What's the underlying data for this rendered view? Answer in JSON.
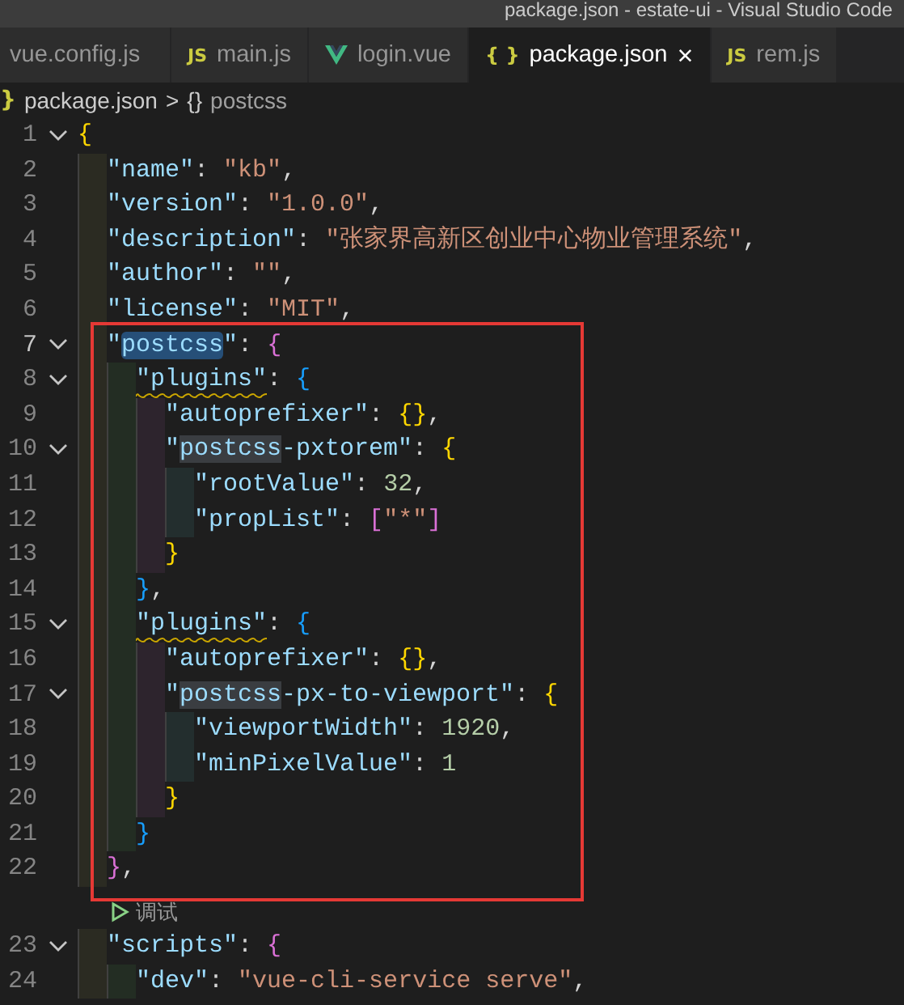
{
  "window": {
    "title": "package.json - estate-ui - Visual Studio Code"
  },
  "tabs": [
    {
      "label": "vue.config.js",
      "selected": false
    },
    {
      "label": "main.js",
      "kind": "js",
      "icon_text": "JS",
      "selected": false
    },
    {
      "label": "login.vue",
      "kind": "vue",
      "selected": false
    },
    {
      "label": "package.json",
      "kind": "json",
      "icon_text": "{ }",
      "selected": true,
      "close_glyph": "×"
    },
    {
      "label": "rem.js",
      "kind": "js",
      "icon_text": "JS",
      "selected": false
    }
  ],
  "breadcrumb": {
    "separator": ">",
    "items": [
      {
        "icon_text": "}",
        "label": "package.json"
      },
      {
        "icon_text": "{}",
        "label": "postcss"
      }
    ]
  },
  "editor": {
    "lines": [
      {
        "kind": "code",
        "n": "1",
        "fold": true,
        "seg": [
          {
            "kind": "b1",
            "t": "{"
          }
        ],
        "children": [
          {
            "kind": "code",
            "n": "2",
            "seg": [
              {
                "kind": "key",
                "t": "\"name\""
              },
              {
                "kind": "p",
                "t": ":"
              },
              {
                "kind": "str",
                "t": "\"kb\""
              },
              {
                "kind": "p",
                "t": ","
              }
            ]
          },
          {
            "kind": "code",
            "n": "3",
            "seg": [
              {
                "kind": "key",
                "t": "\"version\""
              },
              {
                "kind": "p",
                "t": ":"
              },
              {
                "kind": "str",
                "t": "\"1.0.0\""
              },
              {
                "kind": "p",
                "t": ","
              }
            ]
          },
          {
            "kind": "code",
            "n": "4",
            "seg": [
              {
                "kind": "key",
                "t": "\"description\""
              },
              {
                "kind": "p",
                "t": ":"
              },
              {
                "kind": "str",
                "t": "\"张家界高新区创业中心物业管理系统\""
              },
              {
                "kind": "p",
                "t": ","
              }
            ]
          },
          {
            "kind": "code",
            "n": "5",
            "seg": [
              {
                "kind": "key",
                "t": "\"author\""
              },
              {
                "kind": "p",
                "t": ":"
              },
              {
                "kind": "str",
                "t": "\"\""
              },
              {
                "kind": "p",
                "t": ","
              }
            ]
          },
          {
            "kind": "code",
            "n": "6",
            "seg": [
              {
                "kind": "key",
                "t": "\"license\""
              },
              {
                "kind": "p",
                "t": ":"
              },
              {
                "kind": "str",
                "t": "\"MIT\""
              },
              {
                "kind": "p",
                "t": ","
              }
            ]
          },
          {
            "kind": "code",
            "n": "7",
            "fold": true,
            "current": true,
            "seg": [
              {
                "kind": "key",
                "t": "\""
              },
              {
                "kind": "key",
                "t": "postcss",
                "selected": true
              },
              {
                "kind": "key",
                "t": "\""
              },
              {
                "kind": "p",
                "t": ":"
              },
              {
                "kind": "b2",
                "t": "{"
              }
            ],
            "children": [
              {
                "kind": "code",
                "n": "8",
                "fold": true,
                "seg": [
                  {
                    "kind": "key",
                    "t": "\"plugins\"",
                    "warn": true
                  },
                  {
                    "kind": "p",
                    "t": ":"
                  },
                  {
                    "kind": "b3",
                    "t": "{"
                  }
                ],
                "children": [
                  {
                    "kind": "code",
                    "n": "9",
                    "seg": [
                      {
                        "kind": "key",
                        "t": "\"autoprefixer\""
                      },
                      {
                        "kind": "p",
                        "t": ":"
                      },
                      {
                        "kind": "b1",
                        "t": "{}"
                      },
                      {
                        "kind": "p",
                        "t": ","
                      }
                    ]
                  },
                  {
                    "kind": "code",
                    "n": "10",
                    "fold": true,
                    "seg": [
                      {
                        "kind": "key",
                        "t": "\""
                      },
                      {
                        "kind": "key",
                        "t": "postcss",
                        "match": true
                      },
                      {
                        "kind": "key",
                        "t": "-pxtorem\""
                      },
                      {
                        "kind": "p",
                        "t": ":"
                      },
                      {
                        "kind": "b1",
                        "t": "{"
                      }
                    ],
                    "children": [
                      {
                        "kind": "code",
                        "n": "11",
                        "seg": [
                          {
                            "kind": "key",
                            "t": "\"rootValue\""
                          },
                          {
                            "kind": "p",
                            "t": ":"
                          },
                          {
                            "kind": "num",
                            "t": "32"
                          },
                          {
                            "kind": "p",
                            "t": ","
                          }
                        ]
                      },
                      {
                        "kind": "code",
                        "n": "12",
                        "seg": [
                          {
                            "kind": "key",
                            "t": "\"propList\""
                          },
                          {
                            "kind": "p",
                            "t": ":"
                          },
                          {
                            "kind": "b2",
                            "t": "["
                          },
                          {
                            "kind": "str",
                            "t": "\"*\""
                          },
                          {
                            "kind": "b2",
                            "t": "]"
                          }
                        ]
                      }
                    ]
                  },
                  {
                    "kind": "code",
                    "n": "13",
                    "seg": [
                      {
                        "kind": "b1",
                        "t": "}"
                      }
                    ]
                  }
                ]
              },
              {
                "kind": "code",
                "n": "14",
                "seg": [
                  {
                    "kind": "b3",
                    "t": "}"
                  },
                  {
                    "kind": "p",
                    "t": ","
                  }
                ]
              },
              {
                "kind": "code",
                "n": "15",
                "fold": true,
                "seg": [
                  {
                    "kind": "key",
                    "t": "\"plugins\"",
                    "warn": true
                  },
                  {
                    "kind": "p",
                    "t": ":"
                  },
                  {
                    "kind": "b3",
                    "t": "{"
                  }
                ],
                "children": [
                  {
                    "kind": "code",
                    "n": "16",
                    "seg": [
                      {
                        "kind": "key",
                        "t": "\"autoprefixer\""
                      },
                      {
                        "kind": "p",
                        "t": ":"
                      },
                      {
                        "kind": "b1",
                        "t": "{}"
                      },
                      {
                        "kind": "p",
                        "t": ","
                      }
                    ]
                  },
                  {
                    "kind": "code",
                    "n": "17",
                    "fold": true,
                    "seg": [
                      {
                        "kind": "key",
                        "t": "\""
                      },
                      {
                        "kind": "key",
                        "t": "postcss",
                        "match": true
                      },
                      {
                        "kind": "key",
                        "t": "-px-to-viewport\""
                      },
                      {
                        "kind": "p",
                        "t": ":"
                      },
                      {
                        "kind": "b1",
                        "t": "{"
                      }
                    ],
                    "children": [
                      {
                        "kind": "code",
                        "n": "18",
                        "seg": [
                          {
                            "kind": "key",
                            "t": "\"viewportWidth\""
                          },
                          {
                            "kind": "p",
                            "t": ":"
                          },
                          {
                            "kind": "num",
                            "t": "1920"
                          },
                          {
                            "kind": "p",
                            "t": ","
                          }
                        ]
                      },
                      {
                        "kind": "code",
                        "n": "19",
                        "seg": [
                          {
                            "kind": "key",
                            "t": "\"minPixelValue\""
                          },
                          {
                            "kind": "p",
                            "t": ":"
                          },
                          {
                            "kind": "num",
                            "t": "1"
                          }
                        ]
                      }
                    ]
                  },
                  {
                    "kind": "code",
                    "n": "20",
                    "seg": [
                      {
                        "kind": "b1",
                        "t": "}"
                      }
                    ]
                  }
                ]
              },
              {
                "kind": "code",
                "n": "21",
                "seg": [
                  {
                    "kind": "b3",
                    "t": "}"
                  }
                ]
              }
            ]
          },
          {
            "kind": "code",
            "n": "22",
            "seg": [
              {
                "kind": "b2",
                "t": "}"
              },
              {
                "kind": "p",
                "t": ","
              }
            ]
          },
          {
            "kind": "codelens",
            "label": "调试"
          },
          {
            "kind": "code",
            "n": "23",
            "fold": true,
            "seg": [
              {
                "kind": "key",
                "t": "\"scripts\""
              },
              {
                "kind": "p",
                "t": ":"
              },
              {
                "kind": "b2",
                "t": "{"
              }
            ],
            "children": [
              {
                "kind": "code",
                "n": "24",
                "seg": [
                  {
                    "kind": "key",
                    "t": "\"dev\""
                  },
                  {
                    "kind": "p",
                    "t": ":"
                  },
                  {
                    "kind": "str",
                    "t": "\"vue-cli-service serve\""
                  },
                  {
                    "kind": "p",
                    "t": ","
                  }
                ]
              }
            ]
          }
        ]
      }
    ]
  }
}
